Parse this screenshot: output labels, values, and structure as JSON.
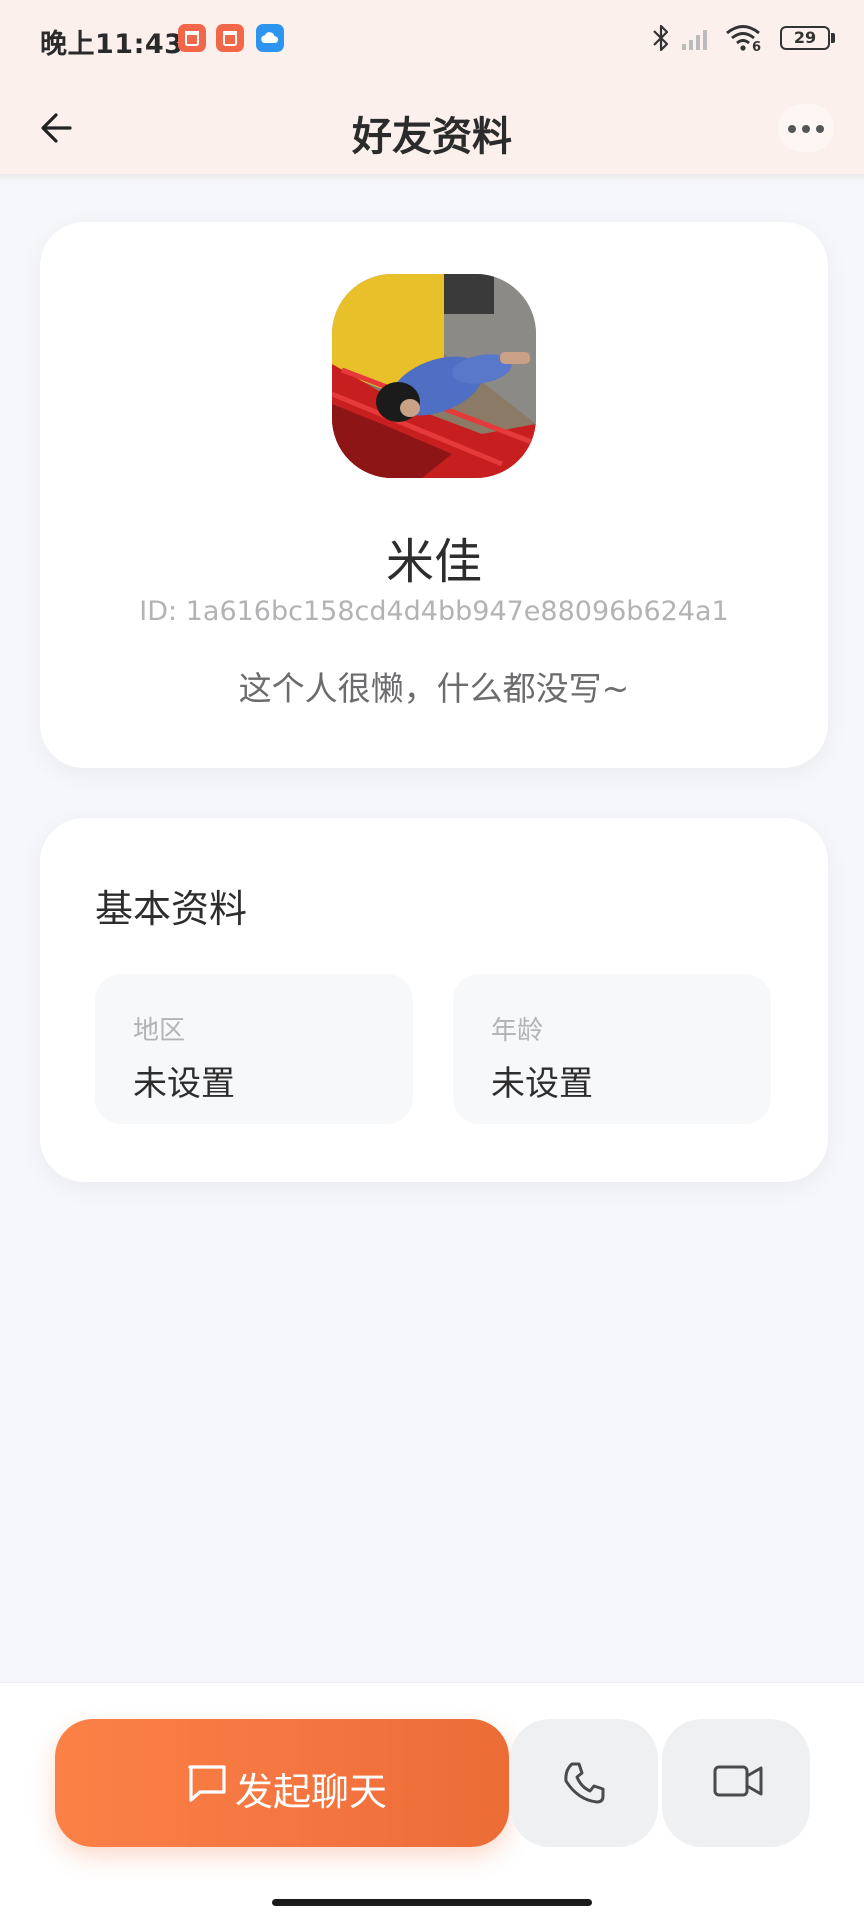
{
  "status_bar": {
    "time": "晚上11:43",
    "battery": "29",
    "network_badge": "6",
    "icons": [
      "app-notification-icon",
      "app-notification-icon",
      "cloud-app-icon",
      "bluetooth-icon",
      "cellular-signal-icon",
      "wifi-icon",
      "battery-icon"
    ]
  },
  "header": {
    "title": "好友资料",
    "back_icon": "arrow-left-icon",
    "more_icon": "more-dots-icon"
  },
  "profile": {
    "name": "米佳",
    "id_text": "ID: 1a616bc158cd4d4bb947e88096b624a1",
    "bio": "这个人很懒，什么都没写~"
  },
  "basic_info": {
    "title": "基本资料",
    "items": [
      {
        "label": "地区",
        "value": "未设置"
      },
      {
        "label": "年龄",
        "value": "未设置"
      }
    ]
  },
  "actions": {
    "chat_label": "发起聊天",
    "chat_icon": "message-square-icon",
    "voice_icon": "phone-icon",
    "video_icon": "video-camera-icon"
  },
  "colors": {
    "accent": "#f3743f",
    "header_bg": "#fbf0ec",
    "page_bg": "#f6f7fa"
  }
}
